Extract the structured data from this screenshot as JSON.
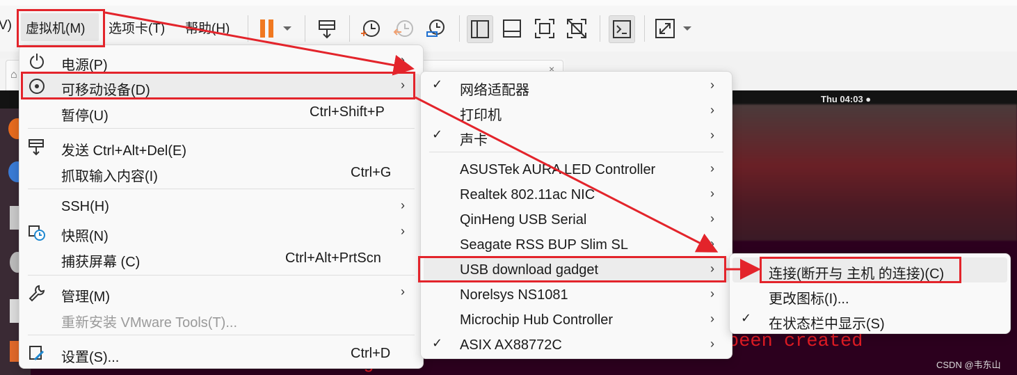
{
  "menubar": {
    "left_fragment": "V)",
    "vm_menu": "虚拟机(M)",
    "tabs_menu": "选项卡(T)",
    "help_menu": "帮助(H)"
  },
  "toolbar_icons": [
    "pause-icon",
    "dropdown-icon",
    "send-keys-icon",
    "snapshot-icon",
    "revert-snapshot-icon",
    "snapshot-manager-icon",
    "library-view-icon",
    "thumbnail-bar-icon",
    "fullscreen-icon",
    "unity-icon",
    "console-icon",
    "stretch-icon"
  ],
  "guest": {
    "clock": "Thu 04:03 ●",
    "term_line1": "been created",
    "term_line2": "or been moved out of incoming."
  },
  "watermark": "CSDN @韦东山",
  "vm_menu": [
    {
      "label": "电源(P)",
      "shortcut": "",
      "arrow": true,
      "icon": "power-icon"
    },
    {
      "label": "可移动设备(D)",
      "shortcut": "",
      "arrow": true,
      "icon": "removable-device-icon"
    },
    {
      "label": "暂停(U)",
      "shortcut": "Ctrl+Shift+P",
      "arrow": false,
      "icon": ""
    },
    {
      "label": "发送 Ctrl+Alt+Del(E)",
      "shortcut": "",
      "arrow": false,
      "icon": "send-cad-icon"
    },
    {
      "label": "抓取输入内容(I)",
      "shortcut": "Ctrl+G",
      "arrow": false,
      "icon": ""
    },
    {
      "label": "SSH(H)",
      "shortcut": "",
      "arrow": true,
      "icon": ""
    },
    {
      "label": "快照(N)",
      "shortcut": "",
      "arrow": true,
      "icon": "snapshot-icon"
    },
    {
      "label": "捕获屏幕 (C)",
      "shortcut": "Ctrl+Alt+PrtScn",
      "arrow": false,
      "icon": ""
    },
    {
      "label": "管理(M)",
      "shortcut": "",
      "arrow": true,
      "icon": "wrench-icon"
    },
    {
      "label": "重新安装 VMware Tools(T)...",
      "shortcut": "",
      "arrow": false,
      "icon": "",
      "disabled": true
    },
    {
      "label": "设置(S)...",
      "shortcut": "Ctrl+D",
      "arrow": false,
      "icon": "settings-icon"
    }
  ],
  "devices_menu": [
    {
      "label": "网络适配器",
      "checked": true
    },
    {
      "label": "打印机",
      "checked": false
    },
    {
      "label": "声卡",
      "checked": true
    },
    {
      "label": "ASUSTek AURA LED Controller",
      "checked": false
    },
    {
      "label": "Realtek 802.11ac NIC",
      "checked": false
    },
    {
      "label": "QinHeng USB Serial",
      "checked": false
    },
    {
      "label": "Seagate RSS BUP Slim SL",
      "checked": false
    },
    {
      "label": "USB download gadget",
      "checked": false
    },
    {
      "label": "Norelsys NS1081",
      "checked": false
    },
    {
      "label": "Microchip Hub Controller",
      "checked": false
    },
    {
      "label": "ASIX AX88772C",
      "checked": true
    }
  ],
  "usb_menu": [
    {
      "label": "连接(断开与 主机 的连接)(C)",
      "checked": false
    },
    {
      "label": "更改图标(I)...",
      "checked": false
    },
    {
      "label": "在状态栏中显示(S)",
      "checked": true
    }
  ],
  "colors": {
    "annotation": "#e3242b",
    "pause": "#f07820",
    "guest_bg": "#2c001e",
    "terminal_red": "#e01b24"
  }
}
